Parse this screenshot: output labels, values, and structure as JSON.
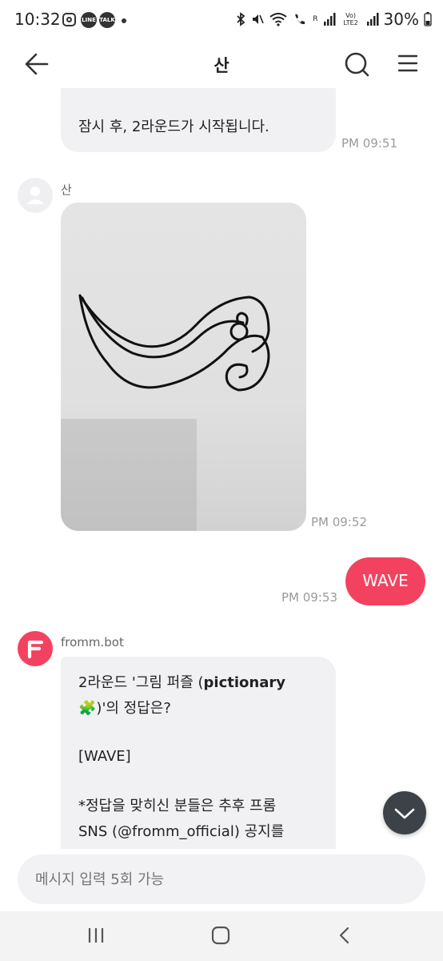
{
  "status_bar": {
    "time": "10:32",
    "app_icon_line": "LINE",
    "app_icon_talk": "TALK",
    "battery": "30%",
    "network_r": "R",
    "network_lte": "Vo) LTE2"
  },
  "header": {
    "title": "산",
    "back_icon": "arrow-left-icon",
    "search_icon": "search-icon",
    "menu_icon": "hamburger-menu-icon"
  },
  "messages": [
    {
      "type": "received-text",
      "text": "잠시 후, 2라운드가 시작됩니다.",
      "time": "PM 09:51"
    },
    {
      "type": "received-image",
      "sender": "산",
      "time": "PM 09:52"
    },
    {
      "type": "sent-text",
      "text": "WAVE",
      "time": "PM 09:53"
    },
    {
      "type": "received-text",
      "sender": "fromm.bot",
      "line1_prefix": "2라운드 '그림 퍼즐 (",
      "line1_bold": "pictionary",
      "line2_emoji": "🧩",
      "line2_suffix": ")'의 정답은?",
      "answer": "[WAVE]",
      "note_line1": "*정답을 맞히신 분들은 추후 프롬",
      "note_line2": "SNS (@fromm_official) 공지를"
    }
  ],
  "input": {
    "placeholder": "메시지 입력 5회 가능"
  },
  "nav": {
    "recents_icon": "recents-icon",
    "home_icon": "home-icon",
    "back_icon": "nav-back-icon"
  },
  "colors": {
    "accent": "#f2425f",
    "bubble": "#f1f1f3",
    "time": "#9a9a9a"
  }
}
